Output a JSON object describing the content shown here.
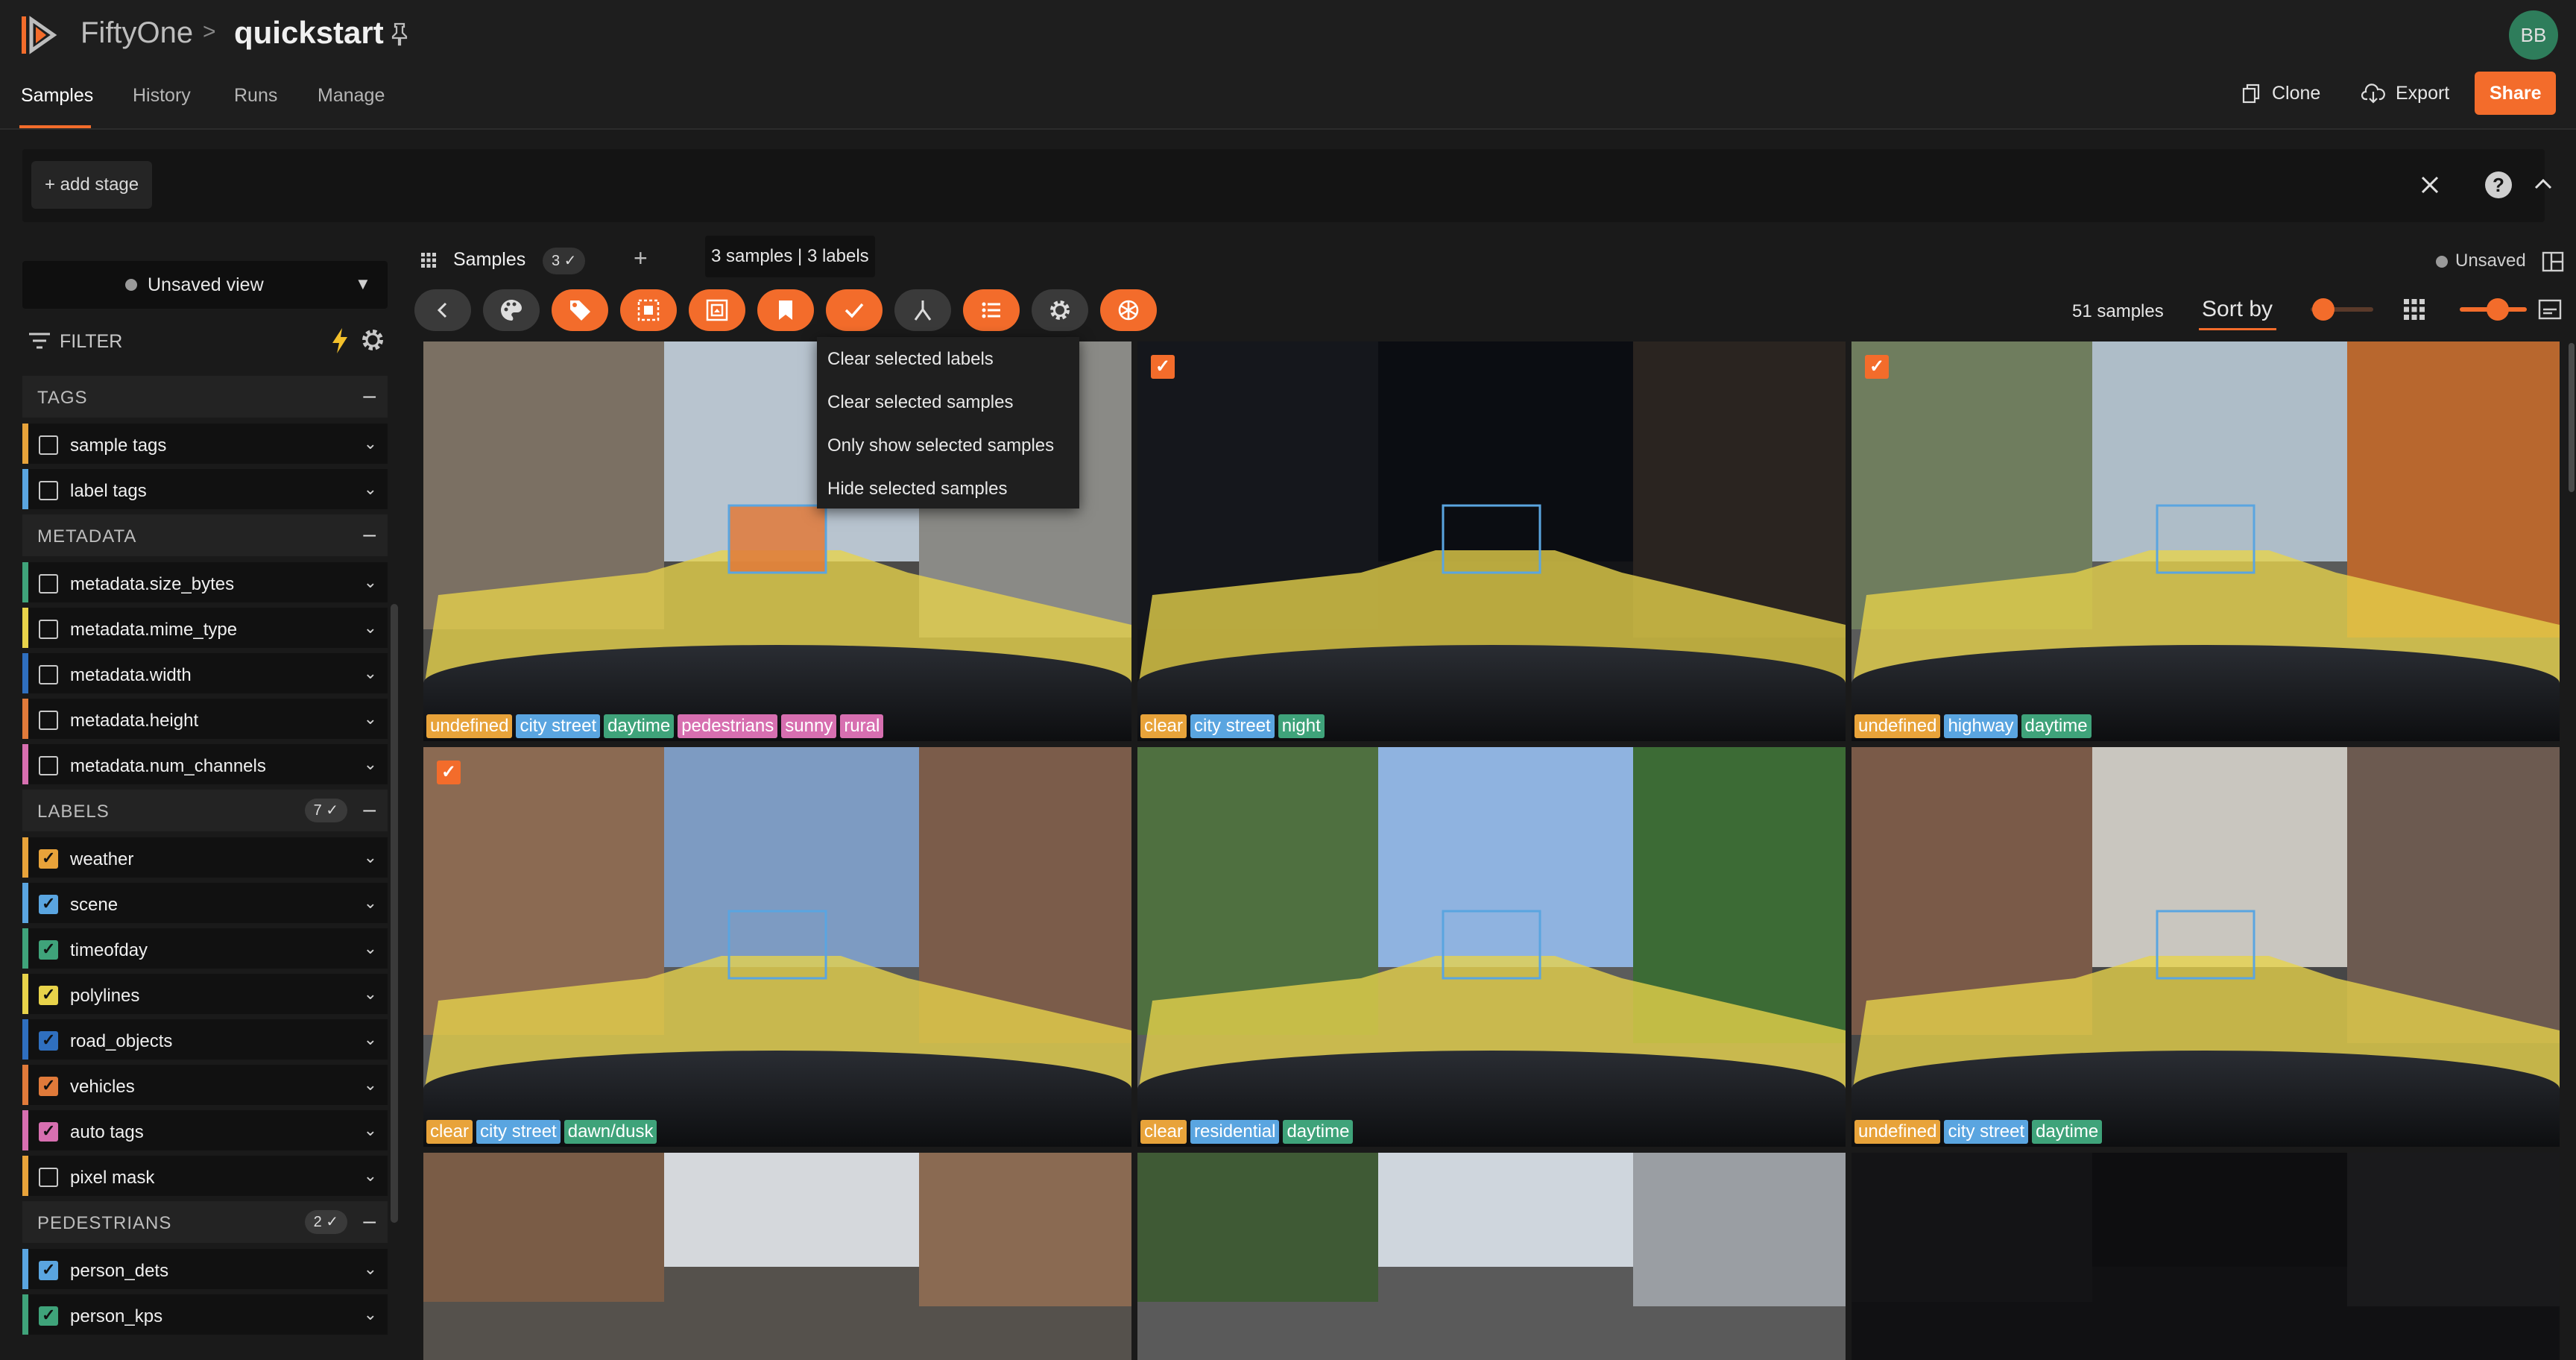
{
  "header": {
    "app_name": "FiftyOne",
    "separator": ">",
    "dataset_name": "quickstart",
    "avatar": "BB",
    "tabs": [
      "Samples",
      "History",
      "Runs",
      "Manage"
    ],
    "clone_label": "Clone",
    "export_label": "Export",
    "share_label": "Share"
  },
  "stage_bar": {
    "add_stage_label": "+ add stage"
  },
  "sidebar": {
    "view_label": "Unsaved view",
    "filter_label": "FILTER",
    "sections": [
      {
        "title": "TAGS",
        "badge": "",
        "rows": [
          {
            "label": "sample tags",
            "color": "#e8a33a",
            "checked": false
          },
          {
            "label": "label tags",
            "color": "#5aa5e0",
            "checked": false
          }
        ]
      },
      {
        "title": "METADATA",
        "badge": "",
        "rows": [
          {
            "label": "metadata.size_bytes",
            "color": "#3fa37a",
            "checked": false
          },
          {
            "label": "metadata.mime_type",
            "color": "#e8d34a",
            "checked": false
          },
          {
            "label": "metadata.width",
            "color": "#2f6fbf",
            "checked": false
          },
          {
            "label": "metadata.height",
            "color": "#e07a3a",
            "checked": false
          },
          {
            "label": "metadata.num_channels",
            "color": "#d76fb0",
            "checked": false
          }
        ]
      },
      {
        "title": "LABELS",
        "badge": "7 ✓",
        "rows": [
          {
            "label": "weather",
            "color": "#e8a33a",
            "checked": true
          },
          {
            "label": "scene",
            "color": "#5aa5e0",
            "checked": true
          },
          {
            "label": "timeofday",
            "color": "#3fa37a",
            "checked": true
          },
          {
            "label": "polylines",
            "color": "#e8d34a",
            "checked": true
          },
          {
            "label": "road_objects",
            "color": "#2f6fbf",
            "checked": true
          },
          {
            "label": "vehicles",
            "color": "#e07a3a",
            "checked": true
          },
          {
            "label": "auto tags",
            "color": "#d76fb0",
            "checked": true
          },
          {
            "label": "pixel mask",
            "color": "#e8a33a",
            "checked": false
          }
        ]
      },
      {
        "title": "PEDESTRIANS",
        "badge": "2 ✓",
        "rows": [
          {
            "label": "person_dets",
            "color": "#5aa5e0",
            "checked": true
          },
          {
            "label": "person_kps",
            "color": "#3fa37a",
            "checked": true
          }
        ]
      }
    ]
  },
  "panel": {
    "tab_label": "Samples",
    "tab_count": "3 ✓",
    "tooltip": "3 samples | 3 labels",
    "unsaved_label": "Unsaved",
    "samples_count": "51 samples",
    "sort_label": "Sort by",
    "menu_items": [
      "Clear selected labels",
      "Clear selected samples",
      "Only show selected samples",
      "Hide selected samples"
    ],
    "action_icons": [
      "chevron-left-icon",
      "palette-icon",
      "tag-icon",
      "select-labels-icon",
      "crop-icon",
      "bookmark-icon",
      "check-icon",
      "merge-icon",
      "list-icon",
      "gear-icon",
      "openai-icon"
    ]
  },
  "tiles": [
    {
      "selected": false,
      "tags": [
        "undefined",
        "city street",
        "daytime",
        "pedestrians",
        "sunny",
        "rural"
      ]
    },
    {
      "selected": true,
      "tags": [
        "clear",
        "city street",
        "night"
      ]
    },
    {
      "selected": true,
      "tags": [
        "undefined",
        "highway",
        "daytime"
      ]
    },
    {
      "selected": true,
      "tags": [
        "clear",
        "city street",
        "dawn/dusk"
      ]
    },
    {
      "selected": false,
      "tags": [
        "clear",
        "residential",
        "daytime"
      ]
    },
    {
      "selected": false,
      "tags": [
        "undefined",
        "city street",
        "daytime"
      ]
    },
    {
      "selected": false,
      "tags": []
    },
    {
      "selected": false,
      "tags": []
    },
    {
      "selected": false,
      "tags": []
    }
  ],
  "tag_colors": {
    "undefined": "#e8a33a",
    "clear": "#e8a33a",
    "city street": "#5aa5e0",
    "highway": "#5aa5e0",
    "residential": "#5aa5e0",
    "daytime": "#3fa37a",
    "night": "#3fa37a",
    "dawn/dusk": "#3fa37a",
    "pedestrians": "#d76fb0",
    "sunny": "#d76fb0",
    "rural": "#d76fb0"
  },
  "colors": {
    "accent": "#f36c2b",
    "background": "#1a1a1a",
    "panel": "#111111"
  }
}
